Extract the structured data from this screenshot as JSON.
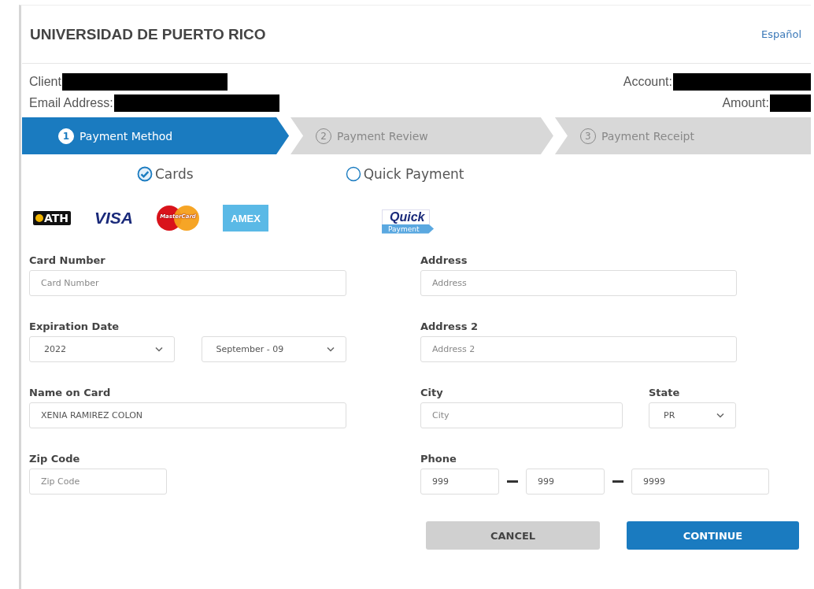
{
  "header": {
    "title": "UNIVERSIDAD DE PUERTO RICO",
    "language_link": "Español"
  },
  "client_info": {
    "left": [
      {
        "label": "Client"
      },
      {
        "label": "Email Address:"
      }
    ],
    "right": [
      {
        "label": "Account:"
      },
      {
        "label": "Amount:"
      }
    ]
  },
  "steps": [
    {
      "number": "1",
      "label": "Payment Method",
      "selected": true
    },
    {
      "number": "2",
      "label": "Payment Review",
      "selected": false
    },
    {
      "number": "3",
      "label": "Payment Receipt",
      "selected": false
    }
  ],
  "payment_options": [
    {
      "label": "Cards",
      "selected": true
    },
    {
      "label": "Quick Payment",
      "selected": false
    }
  ],
  "card_logos": [
    {
      "kind": "ath",
      "text": "ATH"
    },
    {
      "kind": "visa",
      "text": "VISA"
    },
    {
      "kind": "mastercard",
      "text": "MasterCard"
    },
    {
      "kind": "amex",
      "text": "AMEX"
    }
  ],
  "quick_logo": {
    "text": "Quick",
    "subtext": "Payment"
  },
  "form": {
    "left": [
      {
        "fields": [
          {
            "label": "Card Number",
            "inputs": [
              {
                "kind": "text",
                "placeholder": "Card Number"
              }
            ]
          }
        ]
      },
      {
        "fields": [
          {
            "label": "Expiration Date",
            "inputs": [
              {
                "kind": "select",
                "value": "2022"
              },
              {
                "kind": "select",
                "value": "September - 09"
              }
            ]
          }
        ]
      },
      {
        "fields": [
          {
            "label": "Name on Card",
            "inputs": [
              {
                "kind": "text",
                "value": "XENIA RAMIREZ COLON"
              }
            ]
          }
        ]
      },
      {
        "fields": [
          {
            "label": "Zip Code",
            "inputs": [
              {
                "kind": "text",
                "placeholder": "Zip Code"
              }
            ]
          }
        ]
      }
    ],
    "right": [
      {
        "fields": [
          {
            "label": "Address",
            "inputs": [
              {
                "kind": "text",
                "placeholder": "Address"
              }
            ]
          }
        ]
      },
      {
        "fields": [
          {
            "label": "Address 2",
            "inputs": [
              {
                "kind": "text",
                "placeholder": "Address 2"
              }
            ]
          }
        ]
      },
      {
        "fields": [
          {
            "label": "City",
            "inputs": [
              {
                "kind": "text",
                "placeholder": "City"
              }
            ]
          },
          {
            "label": "State",
            "inputs": [
              {
                "kind": "select",
                "value": "PR"
              }
            ]
          }
        ]
      },
      {
        "fields": [
          {
            "label": "Phone",
            "inputs": [
              {
                "kind": "text",
                "value": "999"
              },
              {
                "kind": "text",
                "value": "999"
              },
              {
                "kind": "text",
                "value": "9999"
              }
            ]
          }
        ]
      }
    ]
  },
  "buttons": [
    {
      "label": "CANCEL",
      "kind": "secondary"
    },
    {
      "label": "CONTINUE",
      "kind": "primary"
    }
  ]
}
